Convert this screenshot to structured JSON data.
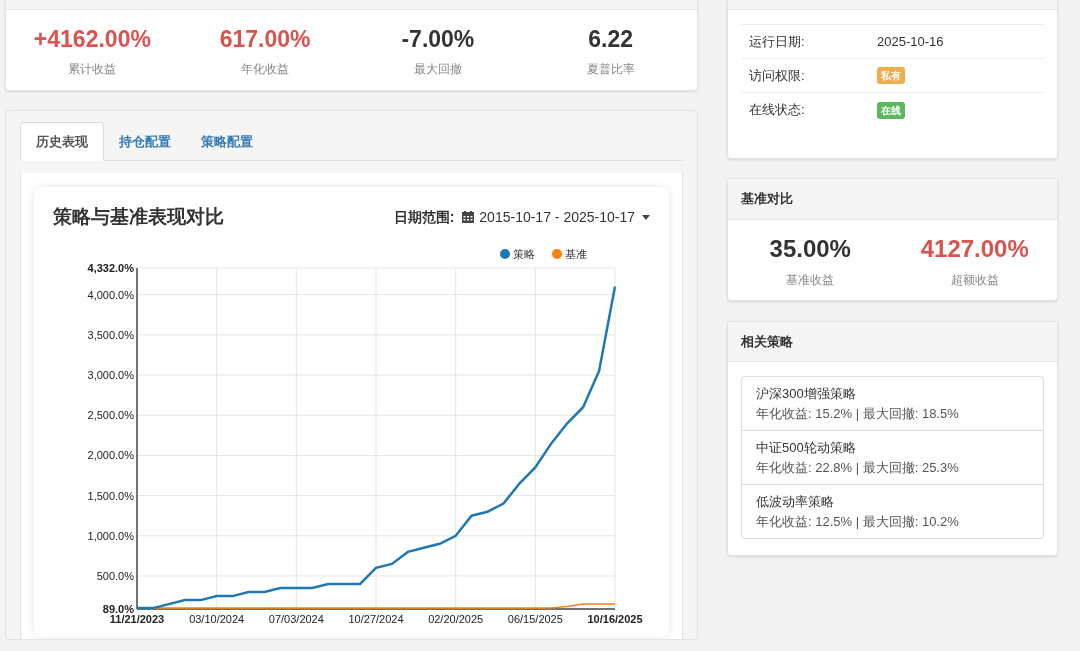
{
  "stats": [
    {
      "value": "+4162.00%",
      "label": "累计收益",
      "color": "#d9534f"
    },
    {
      "value": "617.00%",
      "label": "年化收益",
      "color": "#d9534f"
    },
    {
      "value": "-7.00%",
      "label": "最大回撤",
      "color": "#333333"
    },
    {
      "value": "6.22",
      "label": "夏普比率",
      "color": "#333333"
    }
  ],
  "tabs": [
    {
      "label": "历史表现",
      "selected": true
    },
    {
      "label": "持仓配置",
      "selected": false
    },
    {
      "label": "策略配置",
      "selected": false
    }
  ],
  "chart_card": {
    "title": "策略与基准表现对比",
    "date_range_label": "日期范围:",
    "date_range": "2015-10-17 - 2025-10-17",
    "chart_data": {
      "type": "line",
      "categories": [
        "11/21/2023",
        null,
        null,
        null,
        null,
        "03/10/2024",
        null,
        null,
        null,
        null,
        "07/03/2024",
        null,
        null,
        null,
        null,
        "10/27/2024",
        null,
        null,
        null,
        null,
        "02/20/2025",
        null,
        null,
        null,
        null,
        "06/15/2025",
        null,
        null,
        null,
        null,
        "10/16/2025"
      ],
      "series": [
        {
          "name": "策略",
          "color": "#1f77b4",
          "values": [
            100,
            100,
            150,
            200,
            200,
            250,
            250,
            300,
            300,
            350,
            350,
            350,
            400,
            400,
            400,
            600,
            650,
            800,
            850,
            900,
            1000,
            1250,
            1300,
            1400,
            1650,
            1850,
            2150,
            2400,
            2600,
            3050,
            4100
          ]
        },
        {
          "name": "基准",
          "color": "#ff7f0e",
          "values": [
            100,
            100,
            100,
            100,
            100,
            100,
            100,
            100,
            100,
            100,
            100,
            100,
            100,
            100,
            100,
            100,
            100,
            100,
            100,
            100,
            100,
            100,
            100,
            100,
            100,
            100,
            100,
            120,
            150,
            150,
            150
          ]
        }
      ],
      "ylim": [
        89,
        4332
      ],
      "grid": true,
      "legend": true,
      "yticks": [
        {
          "value": 89,
          "label": "89.0%"
        },
        {
          "value": 500,
          "label": "500.0%"
        },
        {
          "value": 1000,
          "label": "1,000.0%"
        },
        {
          "value": 1500,
          "label": "1,500.0%"
        },
        {
          "value": 2000,
          "label": "2,000.0%"
        },
        {
          "value": 2500,
          "label": "2,500.0%"
        },
        {
          "value": 3000,
          "label": "3,000.0%"
        },
        {
          "value": 3500,
          "label": "3,500.0%"
        },
        {
          "value": 4000,
          "label": "4,000.0%"
        },
        {
          "value": 4332,
          "label": "4,332.0%"
        }
      ]
    }
  },
  "info": {
    "rows": [
      {
        "label": "运行日期:",
        "kind": "text",
        "value": "2025-10-16"
      },
      {
        "label": "访问权限:",
        "kind": "badge",
        "value": "私有",
        "color": "#f0ad4e"
      },
      {
        "label": "在线状态:",
        "kind": "badge",
        "value": "在线",
        "color": "#5cb85c"
      }
    ]
  },
  "benchmark": {
    "title": "基准对比",
    "stats": [
      {
        "value": "35.00%",
        "label": "基准收益",
        "color": "#333333"
      },
      {
        "value": "4127.00%",
        "label": "超额收益",
        "color": "#d9534f"
      }
    ]
  },
  "related": {
    "title": "相关策略",
    "items": [
      {
        "name": "沪深300增强策略",
        "detail": "年化收益: 15.2% | 最大回撤: 18.5%"
      },
      {
        "name": "中证500轮动策略",
        "detail": "年化收益: 22.8% | 最大回撤: 25.3%"
      },
      {
        "name": "低波动率策略",
        "detail": "年化收益: 12.5% | 最大回撤: 10.2%"
      }
    ]
  }
}
